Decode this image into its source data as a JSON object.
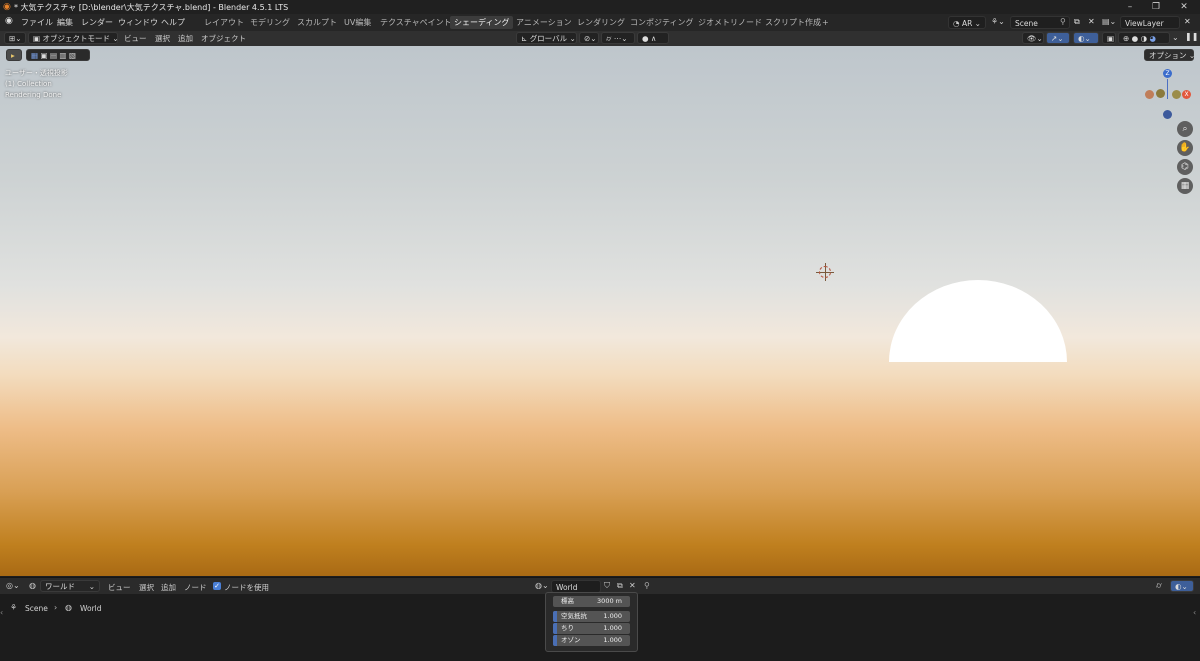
{
  "window": {
    "title": "* 大気テクスチャ [D:\\blender\\大気テクスチャ.blend] - Blender 4.5.1 LTS"
  },
  "topbar": {
    "menus": [
      "ファイル",
      "編集",
      "レンダー",
      "ウィンドウ",
      "ヘルプ"
    ],
    "workspaces": [
      "レイアウト",
      "モデリング",
      "スカルプト",
      "UV編集",
      "テクスチャペイント",
      "シェーディング",
      "アニメーション",
      "レンダリング",
      "コンポジティング",
      "ジオメトリノード",
      "スクリプト作成"
    ],
    "active_workspace": "シェーディング",
    "add_tab": "+",
    "ar_label": "AR",
    "scene": "Scene",
    "view_layer": "ViewLayer"
  },
  "viewport_header": {
    "mode": "オブジェクトモード",
    "menus": [
      "ビュー",
      "選択",
      "追加",
      "オブジェクト"
    ],
    "transform_orientation": "グローバル",
    "options": "オプション"
  },
  "viewport": {
    "overlay_lines": [
      "ユーザー・透視投影",
      "(1) Collection",
      "Rendering Done"
    ],
    "gizmo": {
      "z": "Z",
      "x": "X"
    }
  },
  "node_editor": {
    "world_label": "ワールド",
    "menus": [
      "ビュー",
      "選択",
      "追加",
      "ノード"
    ],
    "use_nodes_label": "ノードを使用",
    "use_nodes_checked": true,
    "world_name": "World",
    "breadcrumb": {
      "scene": "Scene",
      "world": "World"
    },
    "sky_props": [
      {
        "label": "標高",
        "value": "3000 m"
      },
      {
        "label": "空気抵抗",
        "value": "1.000"
      },
      {
        "label": "ちり",
        "value": "1.000"
      },
      {
        "label": "オゾン",
        "value": "1.000"
      }
    ]
  },
  "colors": {
    "accent": "#4a6fb5",
    "gizmo_x": "#e2583e",
    "gizmo_z": "#3b6ccc"
  }
}
